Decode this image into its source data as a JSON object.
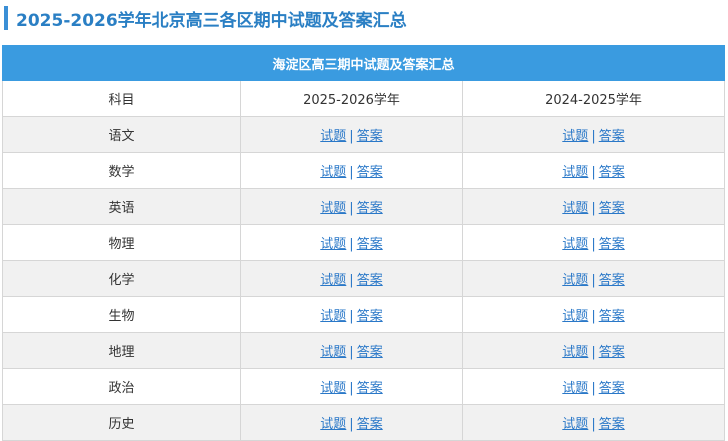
{
  "page": {
    "heading": "2025-2026学年北京高三各区期中试题及答案汇总"
  },
  "table": {
    "banner": "海淀区高三期中试题及答案汇总",
    "headers": [
      "科目",
      "2025-2026学年",
      "2024-2025学年"
    ],
    "link_test": "试题",
    "link_separator": "|",
    "link_answer": "答案",
    "rows": [
      {
        "subject": "语文"
      },
      {
        "subject": "数学"
      },
      {
        "subject": "英语"
      },
      {
        "subject": "物理"
      },
      {
        "subject": "化学"
      },
      {
        "subject": "生物"
      },
      {
        "subject": "地理"
      },
      {
        "subject": "政治"
      },
      {
        "subject": "历史"
      }
    ]
  },
  "colors": {
    "heading_text": "#2a7fc4",
    "heading_bar": "#3a8fd6",
    "banner_bg": "#3a9be0",
    "link": "#2a78c8",
    "row_alt": "#f1f1f1"
  }
}
